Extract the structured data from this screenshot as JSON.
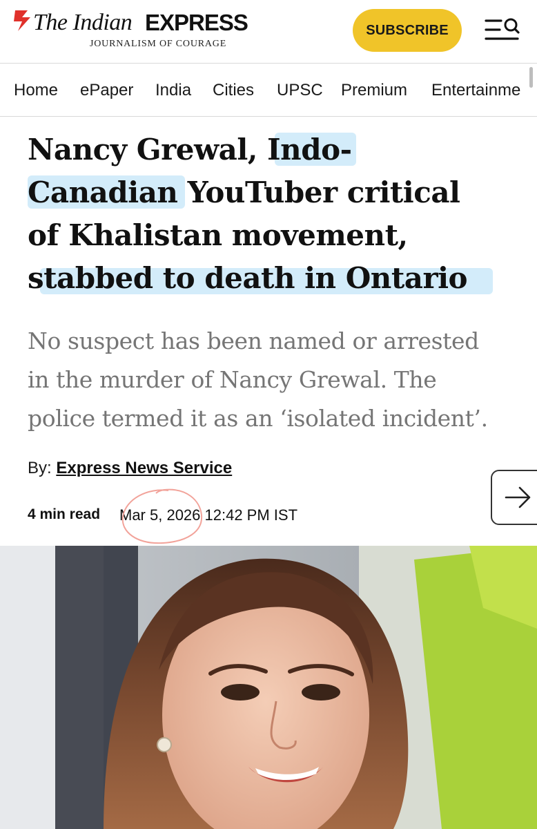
{
  "header": {
    "logo_the": "The Indian",
    "logo_express": "EXPRESS",
    "tagline": "JOURNALISM OF COURAGE",
    "subscribe_label": "SUBSCRIBE",
    "menu_icon": "menu-search-icon"
  },
  "nav": {
    "items": [
      "Home",
      "ePaper",
      "India",
      "Cities",
      "UPSC",
      "Premium",
      "Entertainme"
    ]
  },
  "article": {
    "headline_lines": [
      "Nancy Grewal, Indo-",
      "Canadian YouTuber critical",
      "of Khalistan movement,",
      "stabbed to death in Ontario"
    ],
    "deck_lines": [
      "No suspect has been named or arrested",
      "in the murder of Nancy Grewal. The",
      "police termed it as an ‘isolated incident’."
    ],
    "byline_prefix": "By:",
    "author": "Express News Service",
    "read_time": "4 min read",
    "published": "Mar 5, 2026 12:42 PM IST"
  },
  "colors": {
    "brand_red": "#e0312b",
    "subscribe_yellow": "#f0c429",
    "highlight_blue": "#d3ecfa",
    "circle_annotation": "#f2a39a"
  },
  "icons": {
    "next": "arrow-right-icon"
  }
}
